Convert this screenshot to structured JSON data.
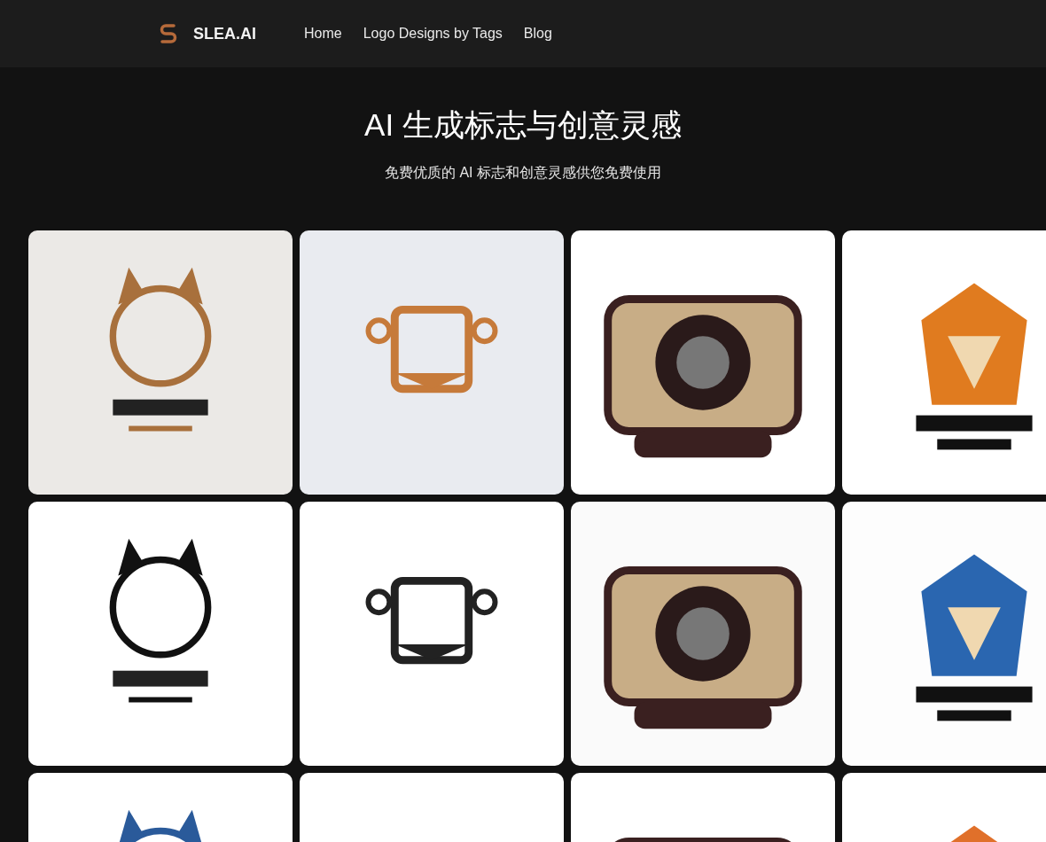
{
  "header": {
    "brand": "SLEA.AI",
    "nav": [
      {
        "label": "Home"
      },
      {
        "label": "Logo Designs by Tags"
      },
      {
        "label": "Blog"
      }
    ]
  },
  "hero": {
    "title": "AI 生成标志与创意灵感",
    "subtitle": "免费优质的 AI 标志和创意灵感供您免费使用"
  }
}
